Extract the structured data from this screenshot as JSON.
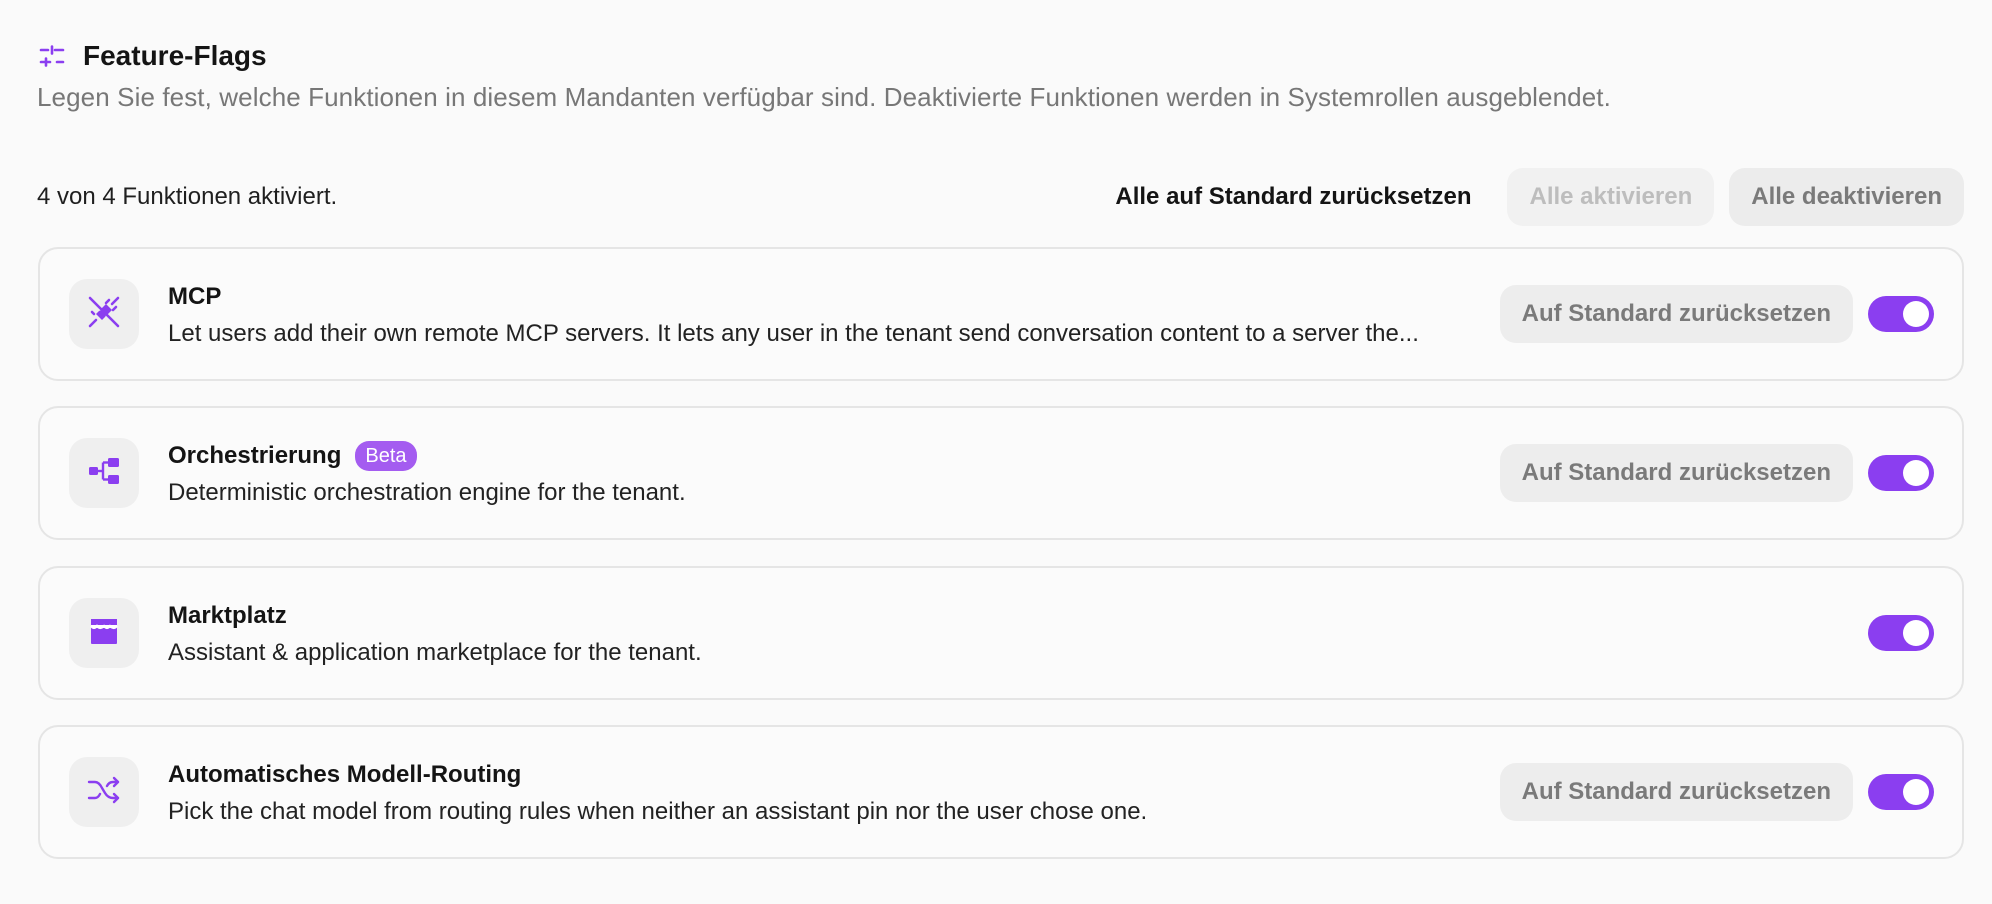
{
  "header": {
    "title": "Feature-Flags",
    "subtitle": "Legen Sie fest, welche Funktionen in diesem Mandanten verfügbar sind. Deaktivierte Funktionen werden in Systemrollen ausgeblendet.",
    "icon": "sliders-icon"
  },
  "toolbar": {
    "count_text": "4 von 4 Funktionen aktiviert.",
    "reset_all_label": "Alle auf Standard zurücksetzen",
    "enable_all_label": "Alle aktivieren",
    "disable_all_label": "Alle deaktivieren"
  },
  "features": [
    {
      "name": "MCP",
      "description": "Let users add their own remote MCP servers. It lets any user in the tenant send conversation content to a server the...",
      "icon": "unplug-icon",
      "reset_label": "Auf Standard zurücksetzen",
      "enabled": true
    },
    {
      "name": "Orchestrierung",
      "badge": "Beta",
      "description": "Deterministic orchestration engine for the tenant.",
      "icon": "workflow-icon",
      "reset_label": "Auf Standard zurücksetzen",
      "enabled": true
    },
    {
      "name": "Marktplatz",
      "description": "Assistant & application marketplace for the tenant.",
      "icon": "store-icon",
      "enabled": true
    },
    {
      "name": "Automatisches Modell-Routing",
      "description": "Pick the chat model from routing rules when neither an assistant pin nor the user chose one.",
      "icon": "shuffle-icon",
      "reset_label": "Auf Standard zurücksetzen",
      "enabled": true
    }
  ],
  "colors": {
    "accent": "#8b3ef0",
    "badge": "#a45cf0",
    "muted_text": "#777777"
  }
}
